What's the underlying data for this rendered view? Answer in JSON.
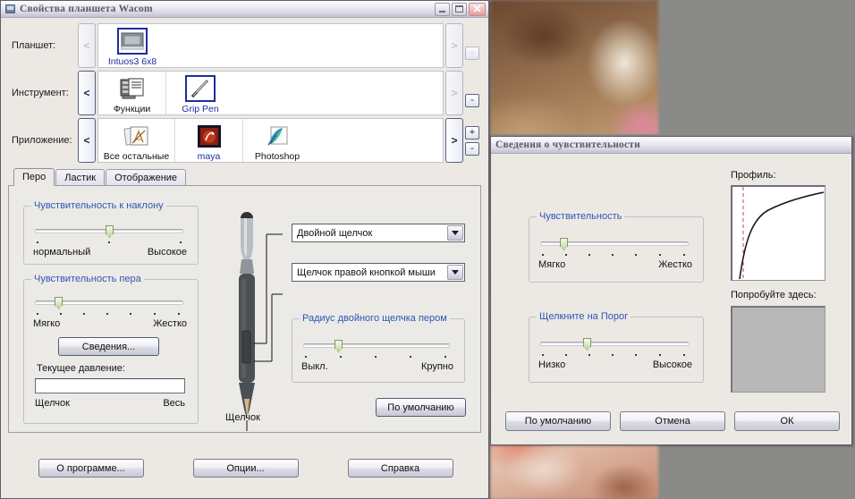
{
  "desktop": {
    "background_color": "#8a8a88",
    "photo_description": "blurred-photo"
  },
  "main_window": {
    "title": "Свойства планшета Wacom",
    "icon": "tablet-icon",
    "controls": {
      "minimize": "minimize-icon",
      "maximize": "maximize-icon",
      "close": "✕"
    },
    "rows": [
      {
        "label": "Планшет:",
        "prev": "<",
        "next": ">",
        "prev_enabled": false,
        "next_enabled": false,
        "plus": null,
        "minus": "-",
        "minus_enabled": false,
        "items": [
          {
            "label": "Intuos3 6x8",
            "icon": "tablet-device-icon",
            "selected": true
          }
        ]
      },
      {
        "label": "Инструмент:",
        "prev": "<",
        "next": ">",
        "prev_enabled": true,
        "next_enabled": false,
        "plus": null,
        "minus": "-",
        "minus_enabled": true,
        "items": [
          {
            "label": "Функции",
            "icon": "functions-icon",
            "selected": false
          },
          {
            "label": "Grip Pen",
            "icon": "grip-pen-icon",
            "selected": true
          }
        ]
      },
      {
        "label": "Приложение:",
        "prev": "<",
        "next": ">",
        "prev_enabled": true,
        "next_enabled": true,
        "plus": "+",
        "minus": "-",
        "minus_enabled": true,
        "items": [
          {
            "label": "Все остальные",
            "icon": "all-others-icon",
            "selected": false
          },
          {
            "label": "maya",
            "icon": "maya-icon",
            "selected": true
          },
          {
            "label": "Photoshop",
            "icon": "photoshop-icon",
            "selected": false
          }
        ]
      }
    ],
    "tabs": [
      {
        "label": "Перо",
        "active": true
      },
      {
        "label": "Ластик",
        "active": false
      },
      {
        "label": "Отображение",
        "active": false
      }
    ],
    "tilt_group": {
      "title": "Чувствительность к наклону",
      "min_label": "нормальный",
      "max_label": "Высокое",
      "ticks": 3,
      "value_index": 1
    },
    "pen_group": {
      "title": "Чувствительность пера",
      "min_label": "Мягко",
      "max_label": "Жестко",
      "ticks": 7,
      "value_index": 1,
      "details_button": "Сведения...",
      "pressure_label": "Текущее давление:",
      "pressure_min": "Щелчок",
      "pressure_max": "Весь",
      "pressure_value": 0
    },
    "pen_diagram": {
      "bottom_label": "Щелчок",
      "icon": "stylus-pen-icon"
    },
    "button_combos": [
      {
        "value": "Двойной щелчок"
      },
      {
        "value": "Щелчок правой кнопкой мыши"
      }
    ],
    "radius_group": {
      "title": "Радиус двойного щелчка пером",
      "min_label": "Выкл.",
      "max_label": "Крупно",
      "ticks": 5,
      "value_index": 1
    },
    "default_button": "По умолчанию",
    "bottom_buttons": [
      "О программе...",
      "Опции...",
      "Справка"
    ]
  },
  "sens_window": {
    "title": "Сведения о чувствительности",
    "sensitivity_group": {
      "title": "Чувствительность",
      "min_label": "Мягко",
      "max_label": "Жестко",
      "ticks": 7,
      "value_index": 1
    },
    "threshold_group": {
      "title": "Щелкните на Порог",
      "min_label": "Низко",
      "max_label": "Высокое",
      "ticks": 7,
      "value_index": 2
    },
    "profile_label": "Профиль:",
    "try_label": "Попробуйте здесь:",
    "buttons": [
      "По умолчанию",
      "Отмена",
      "ОК"
    ]
  }
}
